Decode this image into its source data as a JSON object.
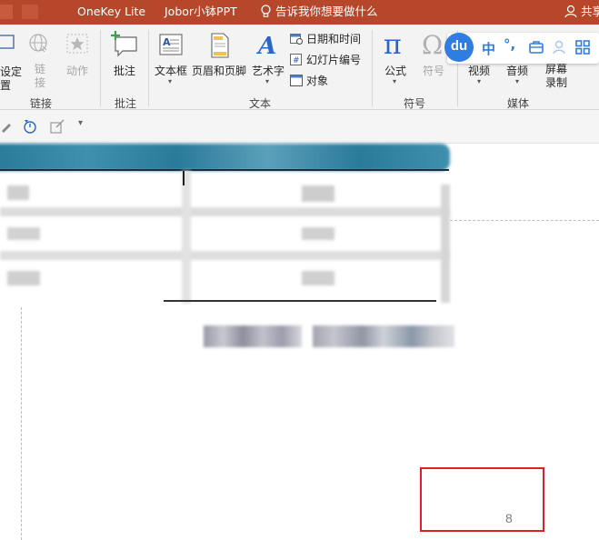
{
  "tabs": {
    "onekey": "OneKey Lite",
    "jobor": "Jobor小钵PPT",
    "tell_me": "告诉我你想要做什么",
    "share": "共享"
  },
  "ribbon": {
    "link_group": {
      "partial_label_1": "设定",
      "partial_label_2": "置",
      "link_btn": "链\n接",
      "action_btn": "动作",
      "group_label": "链接"
    },
    "comment_group": {
      "comment_btn": "批注",
      "group_label": "批注"
    },
    "text_group": {
      "textbox_btn": "文本框",
      "header_footer_btn": "页眉和页脚",
      "wordart_btn": "艺术字",
      "datetime_btn": "日期和时间",
      "slide_number_btn": "幻灯片编号",
      "object_btn": "对象",
      "group_label": "文本"
    },
    "symbol_group": {
      "equation_btn": "公式",
      "symbol_btn": "符号",
      "group_label": "符号"
    },
    "media_group": {
      "video_btn": "视频",
      "audio_btn": "音频",
      "screen_record_btn": "屏幕\n录制",
      "group_label": "媒体"
    }
  },
  "ime": {
    "logo": "du",
    "mode": "中",
    "punct": "°,"
  },
  "slide": {
    "page_number": "8"
  },
  "colors": {
    "tab_bar": "#b7472a",
    "table_header": "#1f6b8c",
    "highlight_box": "#e02020",
    "ime_accent": "#2f7de1"
  }
}
